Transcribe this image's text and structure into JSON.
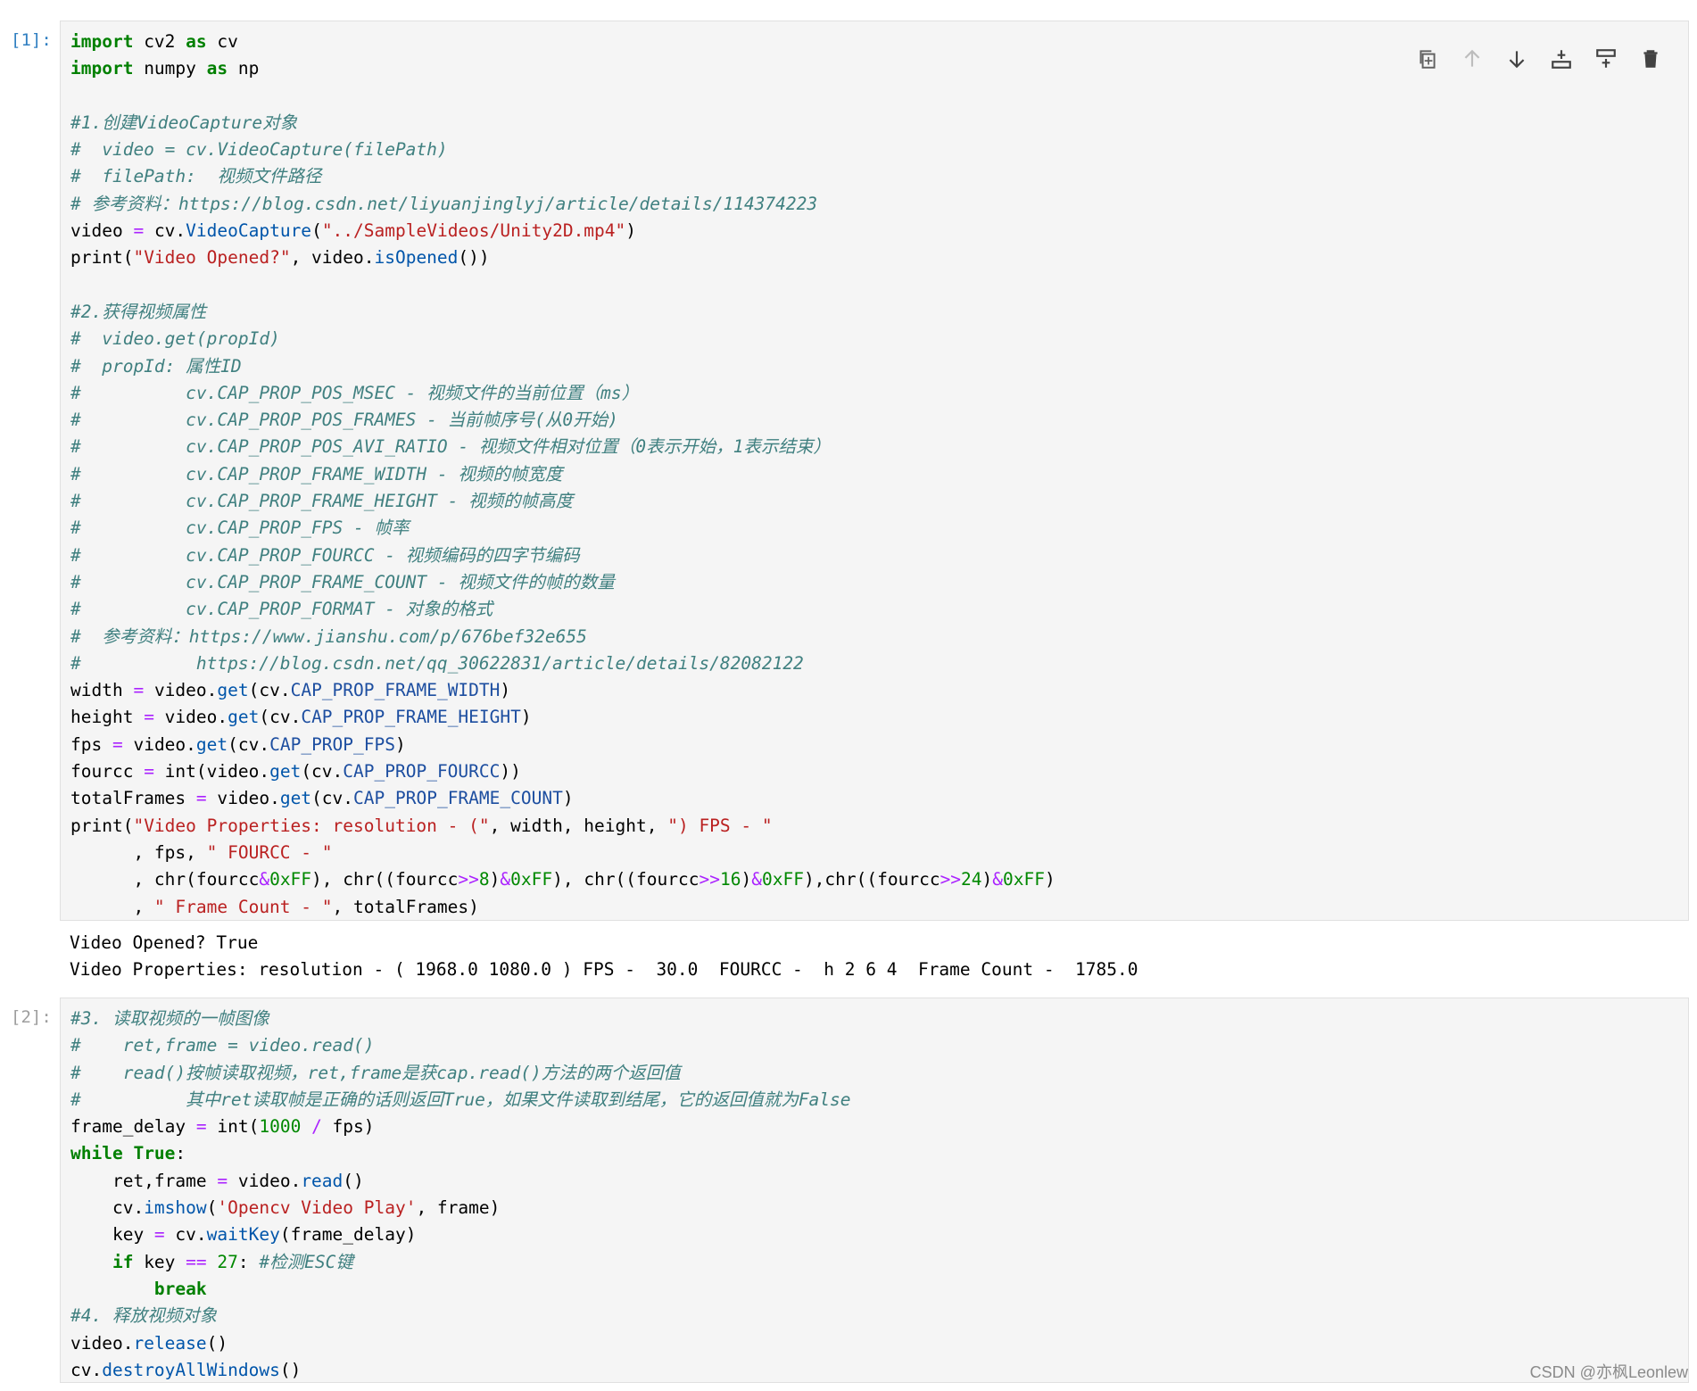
{
  "cells": [
    {
      "prompt": "[1]:",
      "code_lines": [
        [
          {
            "t": "k",
            "v": "import"
          },
          {
            "t": "",
            "v": " cv2 "
          },
          {
            "t": "k",
            "v": "as"
          },
          {
            "t": "",
            "v": " cv"
          }
        ],
        [
          {
            "t": "k",
            "v": "import"
          },
          {
            "t": "",
            "v": " numpy "
          },
          {
            "t": "k",
            "v": "as"
          },
          {
            "t": "",
            "v": " np"
          }
        ],
        [],
        [
          {
            "t": "c",
            "v": "#1.创建VideoCapture对象"
          }
        ],
        [
          {
            "t": "c",
            "v": "#  video = cv.VideoCapture(filePath)"
          }
        ],
        [
          {
            "t": "c",
            "v": "#  filePath:  视频文件路径"
          }
        ],
        [
          {
            "t": "c",
            "v": "# 参考资料：https://blog.csdn.net/liyuanjinglyj/article/details/114374223"
          }
        ],
        [
          {
            "t": "",
            "v": "video "
          },
          {
            "t": "o",
            "v": "="
          },
          {
            "t": "",
            "v": " cv."
          },
          {
            "t": "f",
            "v": "VideoCapture"
          },
          {
            "t": "",
            "v": "("
          },
          {
            "t": "s",
            "v": "\"../SampleVideos/Unity2D.mp4\""
          },
          {
            "t": "",
            "v": ")"
          }
        ],
        [
          {
            "t": "",
            "v": "print("
          },
          {
            "t": "s",
            "v": "\"Video Opened?\""
          },
          {
            "t": "",
            "v": ", video."
          },
          {
            "t": "f",
            "v": "isOpened"
          },
          {
            "t": "",
            "v": "())"
          }
        ],
        [],
        [
          {
            "t": "c",
            "v": "#2.获得视频属性"
          }
        ],
        [
          {
            "t": "c",
            "v": "#  video.get(propId)"
          }
        ],
        [
          {
            "t": "c",
            "v": "#  propId: 属性ID"
          }
        ],
        [
          {
            "t": "c",
            "v": "#          cv.CAP_PROP_POS_MSEC - 视频文件的当前位置（ms）"
          }
        ],
        [
          {
            "t": "c",
            "v": "#          cv.CAP_PROP_POS_FRAMES - 当前帧序号(从0开始)"
          }
        ],
        [
          {
            "t": "c",
            "v": "#          cv.CAP_PROP_POS_AVI_RATIO - 视频文件相对位置（0表示开始，1表示结束）"
          }
        ],
        [
          {
            "t": "c",
            "v": "#          cv.CAP_PROP_FRAME_WIDTH - 视频的帧宽度"
          }
        ],
        [
          {
            "t": "c",
            "v": "#          cv.CAP_PROP_FRAME_HEIGHT - 视频的帧高度"
          }
        ],
        [
          {
            "t": "c",
            "v": "#          cv.CAP_PROP_FPS - 帧率"
          }
        ],
        [
          {
            "t": "c",
            "v": "#          cv.CAP_PROP_FOURCC - 视频编码的四字节编码"
          }
        ],
        [
          {
            "t": "c",
            "v": "#          cv.CAP_PROP_FRAME_COUNT - 视频文件的帧的数量"
          }
        ],
        [
          {
            "t": "c",
            "v": "#          cv.CAP_PROP_FORMAT - 对象的格式"
          }
        ],
        [
          {
            "t": "c",
            "v": "#  参考资料：https://www.jianshu.com/p/676bef32e655"
          }
        ],
        [
          {
            "t": "c",
            "v": "#           https://blog.csdn.net/qq_30622831/article/details/82082122"
          }
        ],
        [
          {
            "t": "",
            "v": "width "
          },
          {
            "t": "o",
            "v": "="
          },
          {
            "t": "",
            "v": " video."
          },
          {
            "t": "f",
            "v": "get"
          },
          {
            "t": "",
            "v": "(cv."
          },
          {
            "t": "a",
            "v": "CAP_PROP_FRAME_WIDTH"
          },
          {
            "t": "",
            "v": ")"
          }
        ],
        [
          {
            "t": "",
            "v": "height "
          },
          {
            "t": "o",
            "v": "="
          },
          {
            "t": "",
            "v": " video."
          },
          {
            "t": "f",
            "v": "get"
          },
          {
            "t": "",
            "v": "(cv."
          },
          {
            "t": "a",
            "v": "CAP_PROP_FRAME_HEIGHT"
          },
          {
            "t": "",
            "v": ")"
          }
        ],
        [
          {
            "t": "",
            "v": "fps "
          },
          {
            "t": "o",
            "v": "="
          },
          {
            "t": "",
            "v": " video."
          },
          {
            "t": "f",
            "v": "get"
          },
          {
            "t": "",
            "v": "(cv."
          },
          {
            "t": "a",
            "v": "CAP_PROP_FPS"
          },
          {
            "t": "",
            "v": ")"
          }
        ],
        [
          {
            "t": "",
            "v": "fourcc "
          },
          {
            "t": "o",
            "v": "="
          },
          {
            "t": "",
            "v": " int(video."
          },
          {
            "t": "f",
            "v": "get"
          },
          {
            "t": "",
            "v": "(cv."
          },
          {
            "t": "a",
            "v": "CAP_PROP_FOURCC"
          },
          {
            "t": "",
            "v": "))"
          }
        ],
        [
          {
            "t": "",
            "v": "totalFrames "
          },
          {
            "t": "o",
            "v": "="
          },
          {
            "t": "",
            "v": " video."
          },
          {
            "t": "f",
            "v": "get"
          },
          {
            "t": "",
            "v": "(cv."
          },
          {
            "t": "a",
            "v": "CAP_PROP_FRAME_COUNT"
          },
          {
            "t": "",
            "v": ")"
          }
        ],
        [
          {
            "t": "",
            "v": "print("
          },
          {
            "t": "s",
            "v": "\"Video Properties: resolution - (\""
          },
          {
            "t": "",
            "v": ", width, height, "
          },
          {
            "t": "s",
            "v": "\") FPS - \""
          }
        ],
        [
          {
            "t": "",
            "v": "      , fps, "
          },
          {
            "t": "s",
            "v": "\" FOURCC - \""
          }
        ],
        [
          {
            "t": "",
            "v": "      , chr(fourcc"
          },
          {
            "t": "o",
            "v": "&"
          },
          {
            "t": "n",
            "v": "0xFF"
          },
          {
            "t": "",
            "v": "), chr((fourcc"
          },
          {
            "t": "o",
            "v": ">>"
          },
          {
            "t": "n",
            "v": "8"
          },
          {
            "t": "",
            "v": ")"
          },
          {
            "t": "o",
            "v": "&"
          },
          {
            "t": "n",
            "v": "0xFF"
          },
          {
            "t": "",
            "v": "), chr((fourcc"
          },
          {
            "t": "o",
            "v": ">>"
          },
          {
            "t": "n",
            "v": "16"
          },
          {
            "t": "",
            "v": ")"
          },
          {
            "t": "o",
            "v": "&"
          },
          {
            "t": "n",
            "v": "0xFF"
          },
          {
            "t": "",
            "v": "),chr((fourcc"
          },
          {
            "t": "o",
            "v": ">>"
          },
          {
            "t": "n",
            "v": "24"
          },
          {
            "t": "",
            "v": ")"
          },
          {
            "t": "o",
            "v": "&"
          },
          {
            "t": "n",
            "v": "0xFF"
          },
          {
            "t": "",
            "v": ")"
          }
        ],
        [
          {
            "t": "",
            "v": "      , "
          },
          {
            "t": "s",
            "v": "\" Frame Count - \""
          },
          {
            "t": "",
            "v": ", totalFrames)"
          }
        ]
      ],
      "output_lines": [
        "Video Opened? True",
        "Video Properties: resolution - ( 1968.0 1080.0 ) FPS -  30.0  FOURCC -  h 2 6 4  Frame Count -  1785.0"
      ]
    },
    {
      "prompt": "[2]:",
      "code_lines": [
        [
          {
            "t": "c",
            "v": "#3. 读取视频的一帧图像"
          }
        ],
        [
          {
            "t": "c",
            "v": "#    ret,frame = video.read()"
          }
        ],
        [
          {
            "t": "c",
            "v": "#    read()按帧读取视频，ret,frame是获cap.read()方法的两个返回值"
          }
        ],
        [
          {
            "t": "c",
            "v": "#          其中ret读取帧是正确的话则返回True，如果文件读取到结尾，它的返回值就为False"
          }
        ],
        [
          {
            "t": "",
            "v": "frame_delay "
          },
          {
            "t": "o",
            "v": "="
          },
          {
            "t": "",
            "v": " int("
          },
          {
            "t": "n",
            "v": "1000"
          },
          {
            "t": "",
            "v": " "
          },
          {
            "t": "o",
            "v": "/"
          },
          {
            "t": "",
            "v": " fps)"
          }
        ],
        [
          {
            "t": "k",
            "v": "while"
          },
          {
            "t": "",
            "v": " "
          },
          {
            "t": "k",
            "v": "True"
          },
          {
            "t": "",
            "v": ":"
          }
        ],
        [
          {
            "t": "",
            "v": "    ret,frame "
          },
          {
            "t": "o",
            "v": "="
          },
          {
            "t": "",
            "v": " video."
          },
          {
            "t": "f",
            "v": "read"
          },
          {
            "t": "",
            "v": "()"
          }
        ],
        [
          {
            "t": "",
            "v": "    cv."
          },
          {
            "t": "f",
            "v": "imshow"
          },
          {
            "t": "",
            "v": "("
          },
          {
            "t": "s",
            "v": "'Opencv Video Play'"
          },
          {
            "t": "",
            "v": ", frame)"
          }
        ],
        [
          {
            "t": "",
            "v": "    key "
          },
          {
            "t": "o",
            "v": "="
          },
          {
            "t": "",
            "v": " cv."
          },
          {
            "t": "f",
            "v": "waitKey"
          },
          {
            "t": "",
            "v": "(frame_delay)"
          }
        ],
        [
          {
            "t": "",
            "v": "    "
          },
          {
            "t": "k",
            "v": "if"
          },
          {
            "t": "",
            "v": " key "
          },
          {
            "t": "o",
            "v": "=="
          },
          {
            "t": "",
            "v": " "
          },
          {
            "t": "n",
            "v": "27"
          },
          {
            "t": "",
            "v": ": "
          },
          {
            "t": "c",
            "v": "#检测ESC键"
          }
        ],
        [
          {
            "t": "",
            "v": "        "
          },
          {
            "t": "k",
            "v": "break"
          }
        ],
        [
          {
            "t": "c",
            "v": "#4. 释放视频对象"
          }
        ],
        [
          {
            "t": "",
            "v": "video."
          },
          {
            "t": "f",
            "v": "release"
          },
          {
            "t": "",
            "v": "()"
          }
        ],
        [
          {
            "t": "",
            "v": "cv."
          },
          {
            "t": "f",
            "v": "destroyAllWindows"
          },
          {
            "t": "",
            "v": "()"
          }
        ]
      ],
      "output_lines": []
    }
  ],
  "toolbar": [
    {
      "icon": "duplicate-icon"
    },
    {
      "icon": "move-up-icon"
    },
    {
      "icon": "move-down-icon"
    },
    {
      "icon": "insert-below-icon"
    },
    {
      "icon": "insert-above-icon"
    },
    {
      "icon": "delete-icon"
    }
  ],
  "watermark": "CSDN @亦枫Leonlew"
}
